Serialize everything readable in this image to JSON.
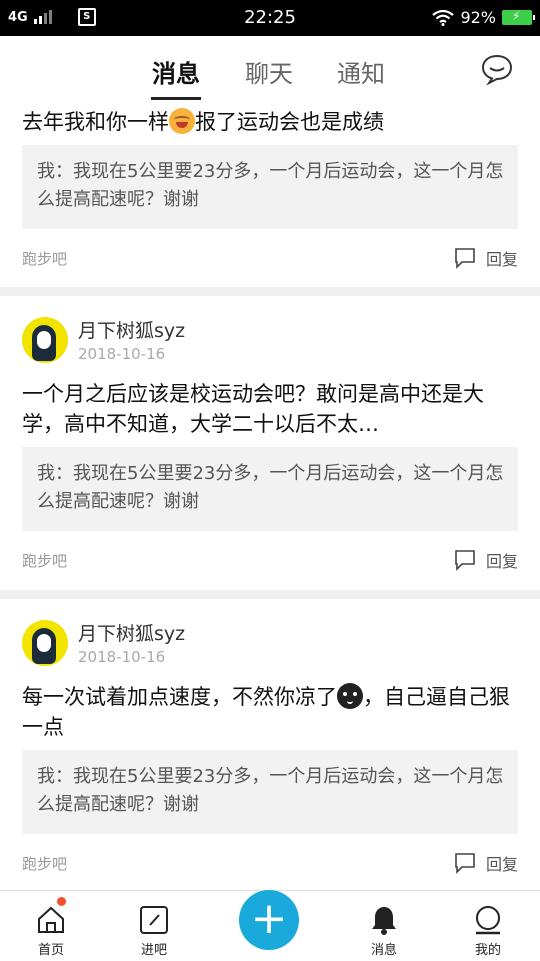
{
  "status": {
    "network": "4G",
    "time": "22:25",
    "battery": "92%"
  },
  "tabs": [
    {
      "label": "消息"
    },
    {
      "label": "聊天"
    },
    {
      "label": "通知"
    }
  ],
  "posts": [
    {
      "content": "去年我和你一样",
      "content_emoji": "smile",
      "content_after": "报了运动会也是成绩",
      "quote": "我：我现在5公里要23分多，一个月后运动会，这一个月怎么提高配速呢？谢谢",
      "tag": "跑步吧",
      "reply": "回复"
    },
    {
      "user": "月下树狐syz",
      "date": "2018-10-16",
      "content": "一个月之后应该是校运动会吧？敢问是高中还是大学，高中不知道，大学二十以后不太…",
      "quote": "我：我现在5公里要23分多，一个月后运动会，这一个月怎么提高配速呢？谢谢",
      "tag": "跑步吧",
      "reply": "回复"
    },
    {
      "user": "月下树狐syz",
      "date": "2018-10-16",
      "content": "每一次试着加点速度，不然你凉了",
      "content_emoji": "cool",
      "content_after": "，自己逼自己狠一点",
      "quote": "我：我现在5公里要23分多，一个月后运动会，这一个月怎么提高配速呢？谢谢",
      "tag": "跑步吧",
      "reply": "回复"
    }
  ],
  "nav": [
    {
      "label": "首页",
      "icon": "home-icon"
    },
    {
      "label": "进吧",
      "icon": "enter-bar-icon"
    },
    {
      "label": "",
      "icon": "plus-icon"
    },
    {
      "label": "消息",
      "icon": "bell-icon"
    },
    {
      "label": "我的",
      "icon": "profile-icon"
    }
  ]
}
